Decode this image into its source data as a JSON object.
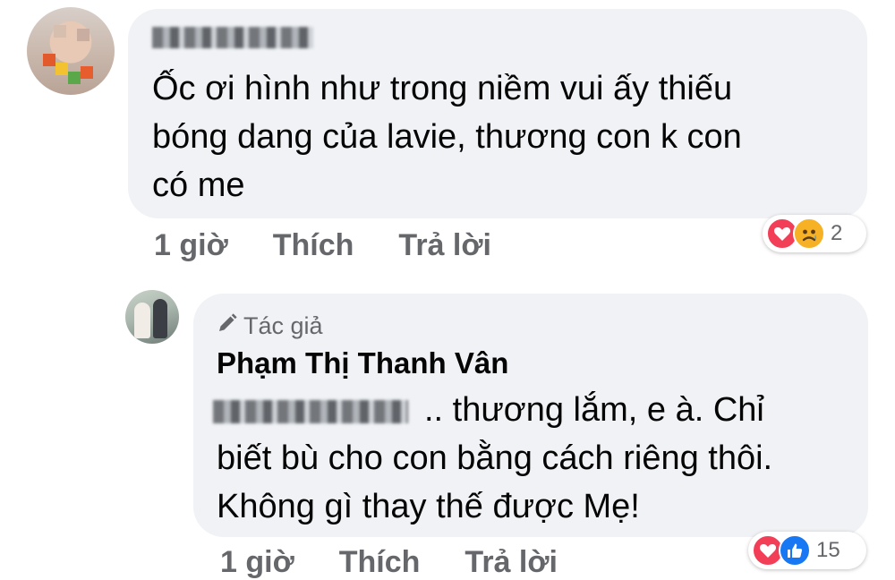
{
  "comments": [
    {
      "text_lines": [
        "Ốc ơi hình như trong niềm vui ấy thiếu",
        "bóng dang của lavie, thương con k con",
        "có me"
      ],
      "actions": {
        "time": "1 giờ",
        "like": "Thích",
        "reply": "Trả lời"
      },
      "reactions": {
        "icons": [
          "love-icon",
          "sad-icon"
        ],
        "count": "2"
      }
    },
    {
      "author_tag": "Tác giả",
      "author_name": "Phạm Thị Thanh Vân",
      "text_first_line": ".. thương lắm, e à. Chỉ",
      "text_lines": [
        "biết bù cho con bằng cách riêng thôi.",
        "Không gì thay thế được Mẹ!"
      ],
      "actions": {
        "time": "1 giờ",
        "like": "Thích",
        "reply": "Trả lời"
      },
      "reactions": {
        "icons": [
          "love-icon",
          "like-icon"
        ],
        "count": "15"
      }
    }
  ],
  "colors": {
    "bubble": "#f0f2f5",
    "text": "#050505",
    "secondary": "#65676b",
    "love": "#f33e58",
    "sad": "#f7b125",
    "like": "#1877f2"
  }
}
